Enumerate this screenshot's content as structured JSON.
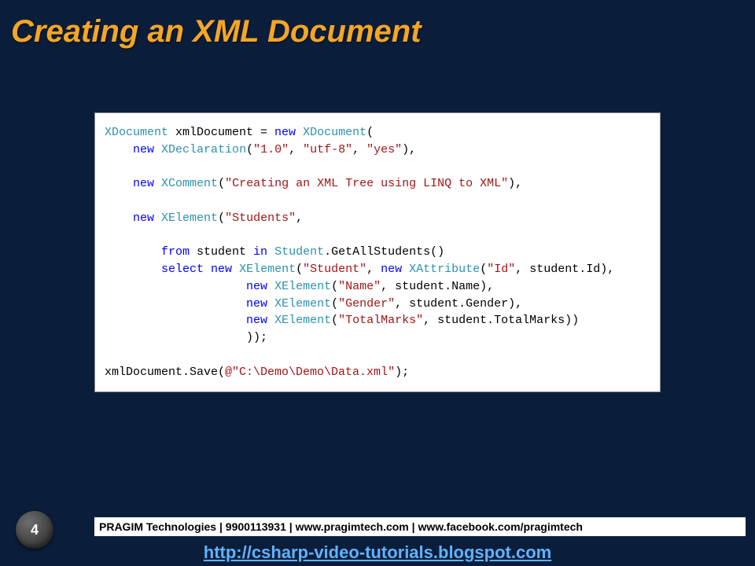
{
  "title": "Creating an XML Document",
  "code": {
    "l1a": "XDocument",
    "l1b": " xmlDocument = ",
    "l1c": "new",
    "l1d": " ",
    "l1e": "XDocument",
    "l1f": "(",
    "l2a": "    ",
    "l2b": "new",
    "l2c": " ",
    "l2d": "XDeclaration",
    "l2e": "(",
    "l2f": "\"1.0\"",
    "l2g": ", ",
    "l2h": "\"utf-8\"",
    "l2i": ", ",
    "l2j": "\"yes\"",
    "l2k": "),",
    "l3a": "    ",
    "l3b": "new",
    "l3c": " ",
    "l3d": "XComment",
    "l3e": "(",
    "l3f": "\"Creating an XML Tree using LINQ to XML\"",
    "l3g": "),",
    "l4a": "    ",
    "l4b": "new",
    "l4c": " ",
    "l4d": "XElement",
    "l4e": "(",
    "l4f": "\"Students\"",
    "l4g": ",",
    "l5a": "        ",
    "l5b": "from",
    "l5c": " student ",
    "l5d": "in",
    "l5e": " ",
    "l5f": "Student",
    "l5g": ".GetAllStudents()",
    "l6a": "        ",
    "l6b": "select",
    "l6c": " ",
    "l6d": "new",
    "l6e": " ",
    "l6f": "XElement",
    "l6g": "(",
    "l6h": "\"Student\"",
    "l6i": ", ",
    "l6j": "new",
    "l6k": " ",
    "l6l": "XAttribute",
    "l6m": "(",
    "l6n": "\"Id\"",
    "l6o": ", student.Id),",
    "l7a": "                    ",
    "l7b": "new",
    "l7c": " ",
    "l7d": "XElement",
    "l7e": "(",
    "l7f": "\"Name\"",
    "l7g": ", student.Name),",
    "l8a": "                    ",
    "l8b": "new",
    "l8c": " ",
    "l8d": "XElement",
    "l8e": "(",
    "l8f": "\"Gender\"",
    "l8g": ", student.Gender),",
    "l9a": "                    ",
    "l9b": "new",
    "l9c": " ",
    "l9d": "XElement",
    "l9e": "(",
    "l9f": "\"TotalMarks\"",
    "l9g": ", student.TotalMarks))",
    "l10a": "                    ));",
    "l11a": "xmlDocument.Save(",
    "l11b": "@\"C:\\Demo\\Demo\\Data.xml\"",
    "l11c": ");"
  },
  "footer_bar": "PRAGIM Technologies | 9900113931 | www.pragimtech.com | www.facebook.com/pragimtech",
  "footer_link": "http://csharp-video-tutorials.blogspot.com",
  "page_number": "4"
}
